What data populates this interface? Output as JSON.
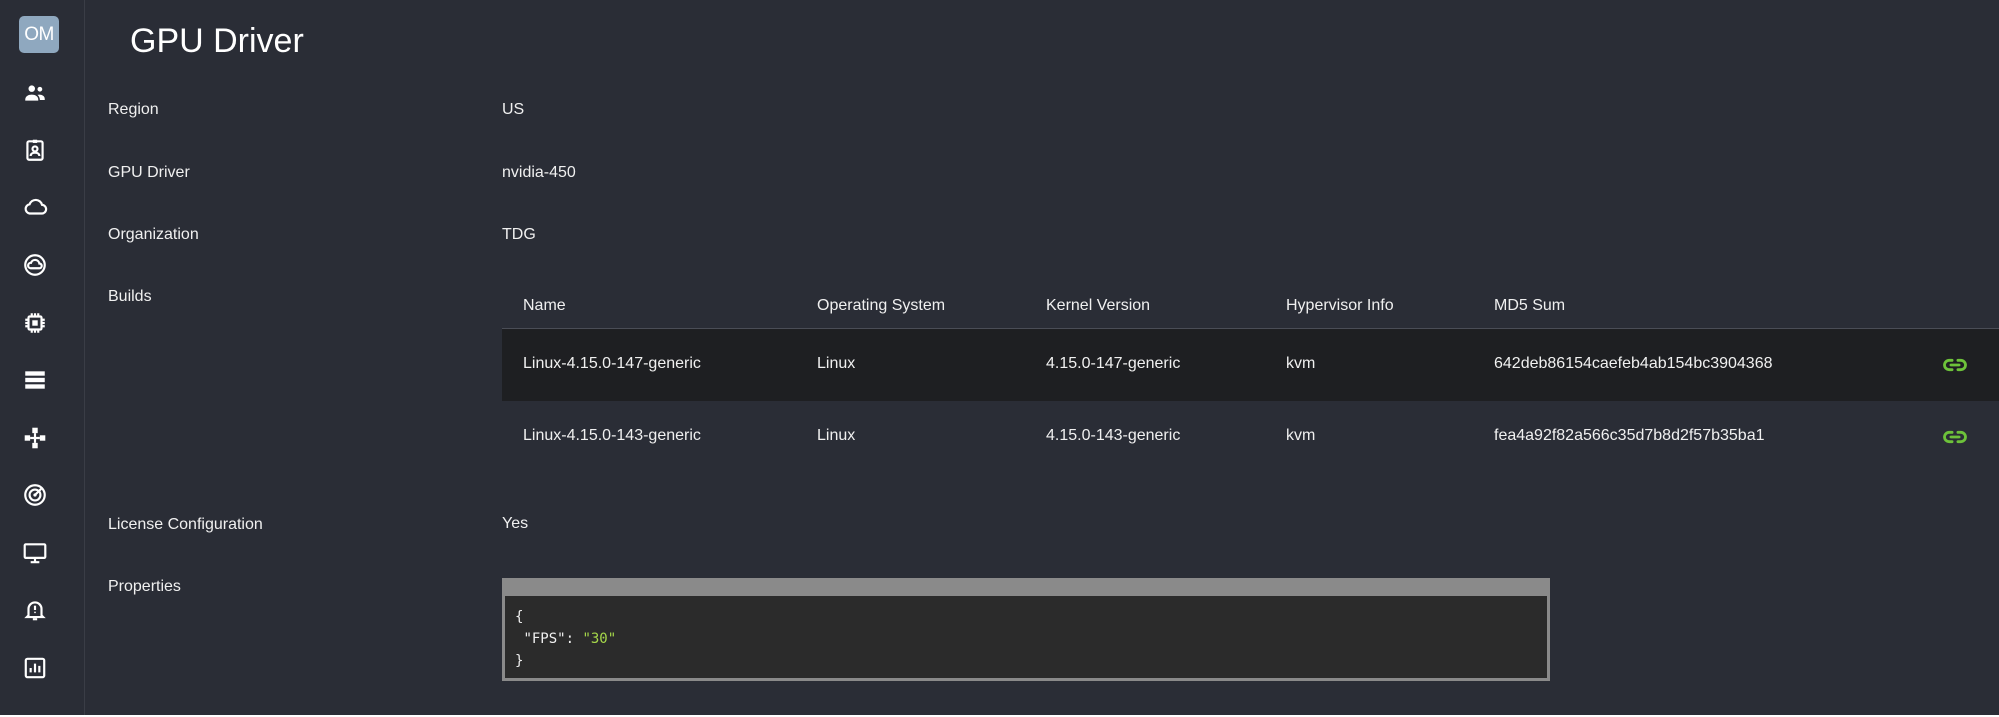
{
  "sidebar": {
    "avatar_initials": "OM",
    "items": [
      {
        "icon": "users-icon"
      },
      {
        "icon": "badge-icon"
      },
      {
        "icon": "cloud-icon"
      },
      {
        "icon": "cloud-circle-icon"
      },
      {
        "icon": "chip-icon"
      },
      {
        "icon": "storage-icon"
      },
      {
        "icon": "network-icon"
      },
      {
        "icon": "radar-icon"
      },
      {
        "icon": "monitor-icon"
      },
      {
        "icon": "alert-bell-icon"
      },
      {
        "icon": "report-chart-icon"
      }
    ]
  },
  "page": {
    "title": "GPU Driver"
  },
  "fields": {
    "region": {
      "label": "Region",
      "value": "US"
    },
    "gpu_driver": {
      "label": "GPU Driver",
      "value": "nvidia-450"
    },
    "organization": {
      "label": "Organization",
      "value": "TDG"
    },
    "builds": {
      "label": "Builds"
    },
    "license": {
      "label": "License Configuration",
      "value": "Yes"
    },
    "properties": {
      "label": "Properties"
    }
  },
  "builds_table": {
    "columns": [
      "Name",
      "Operating System",
      "Kernel Version",
      "Hypervisor Info",
      "MD5 Sum"
    ],
    "rows": [
      {
        "name": "Linux-4.15.0-147-generic",
        "os": "Linux",
        "kernel": "4.15.0-147-generic",
        "hypervisor": "kvm",
        "md5": "642deb86154caefeb4ab154bc3904368",
        "action_icon": "link-icon"
      },
      {
        "name": "Linux-4.15.0-143-generic",
        "os": "Linux",
        "kernel": "4.15.0-143-generic",
        "hypervisor": "kvm",
        "md5": "fea4a92f82a566c35d7b8d2f57b35ba1",
        "action_icon": "link-icon"
      }
    ]
  },
  "properties_json": {
    "open_brace": "{",
    "key": "\"FPS\"",
    "separator": ": ",
    "value": "\"30\"",
    "close_brace": "}"
  },
  "colors": {
    "background": "#2a2d36",
    "row_highlight": "#1e1f22",
    "link_accent": "#6dc23a",
    "json_string": "#a6d84a",
    "avatar_bg": "#8fa8bf"
  }
}
